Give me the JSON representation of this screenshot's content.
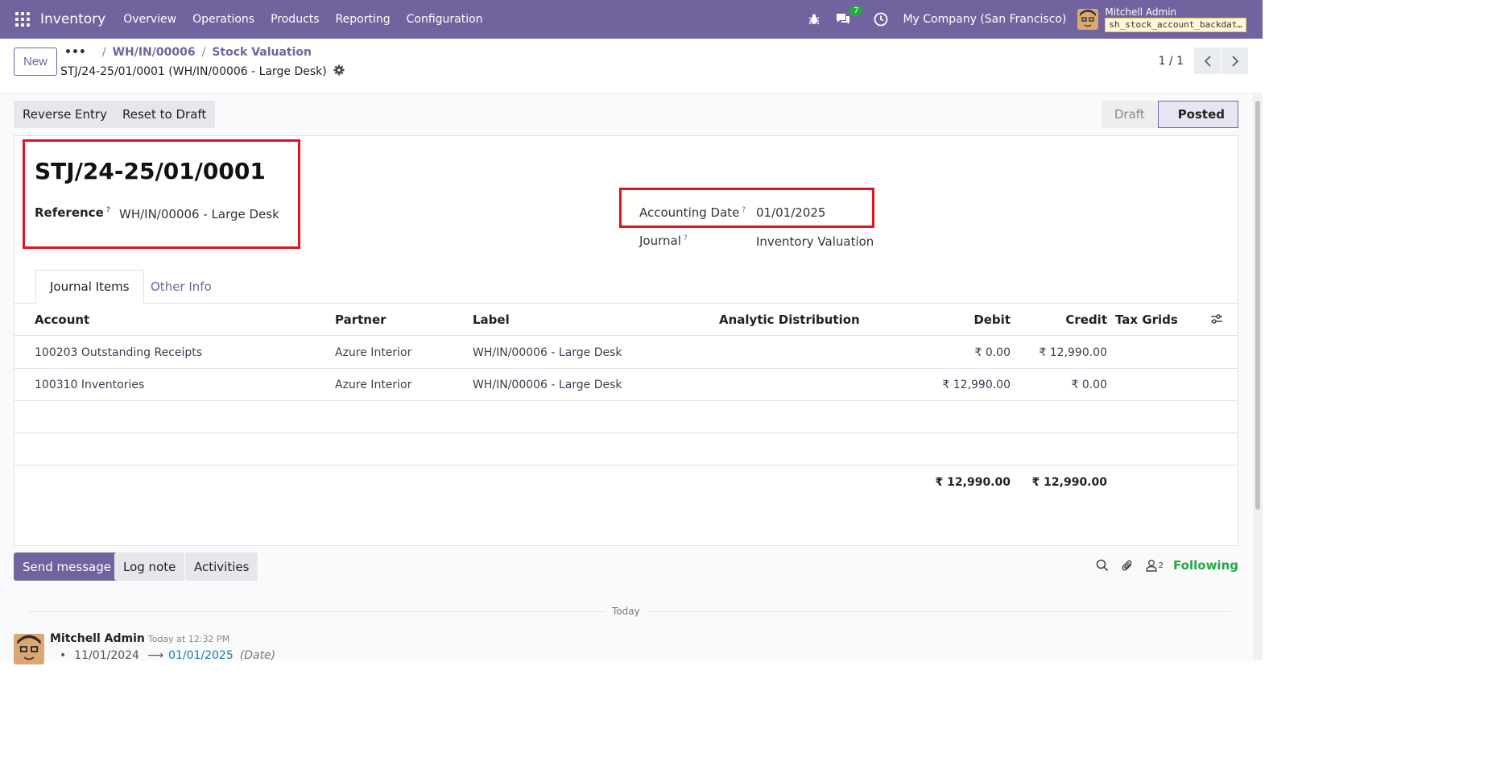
{
  "navbar": {
    "app_name": "Inventory",
    "menu": [
      "Overview",
      "Operations",
      "Products",
      "Reporting",
      "Configuration"
    ],
    "messages_badge": "7",
    "company": "My Company (San Francisco)",
    "user_name": "Mitchell Admin",
    "database": "sh_stock_account_backdat…"
  },
  "control_panel": {
    "new_label": "New",
    "breadcrumb_dots": "•••",
    "breadcrumb": [
      "WH/IN/00006",
      "Stock Valuation"
    ],
    "record_title": "STJ/24-25/01/0001 (WH/IN/00006 - Large Desk)",
    "pager": "1 / 1"
  },
  "actions": {
    "reverse_entry": "Reverse Entry",
    "reset_to_draft": "Reset to Draft"
  },
  "statusbar": [
    "Draft",
    "Posted"
  ],
  "form": {
    "name": "STJ/24-25/01/0001",
    "reference_label": "Reference",
    "reference_value": "WH/IN/00006 - Large Desk",
    "accounting_date_label": "Accounting Date",
    "accounting_date_value": "01/01/2025",
    "journal_label": "Journal",
    "journal_value": "Inventory Valuation",
    "help_mark": "?"
  },
  "tabs": [
    "Journal Items",
    "Other Info"
  ],
  "journal_items": {
    "columns": [
      "Account",
      "Partner",
      "Label",
      "Analytic Distribution",
      "Debit",
      "Credit",
      "Tax Grids"
    ],
    "rows": [
      {
        "account": "100203 Outstanding Receipts",
        "partner": "Azure Interior",
        "label": "WH/IN/00006 - Large Desk",
        "debit": "₹ 0.00",
        "credit": "₹ 12,990.00"
      },
      {
        "account": "100310 Inventories",
        "partner": "Azure Interior",
        "label": "WH/IN/00006 - Large Desk",
        "debit": "₹ 12,990.00",
        "credit": "₹ 0.00"
      }
    ],
    "total_debit": "₹ 12,990.00",
    "total_credit": "₹ 12,990.00"
  },
  "chatter": {
    "send_message": "Send message",
    "log_note": "Log note",
    "activities": "Activities",
    "followers_count": "2",
    "following": "Following",
    "today": "Today",
    "message": {
      "author": "Mitchell Admin",
      "time": "Today at 12:32 PM",
      "old_value": "11/01/2024",
      "arrow": "⟶",
      "new_value": "01/01/2025",
      "field": "(Date)"
    }
  },
  "colors": {
    "brand": "#71639e",
    "highlight": "#e0141e",
    "following": "#28a745"
  }
}
